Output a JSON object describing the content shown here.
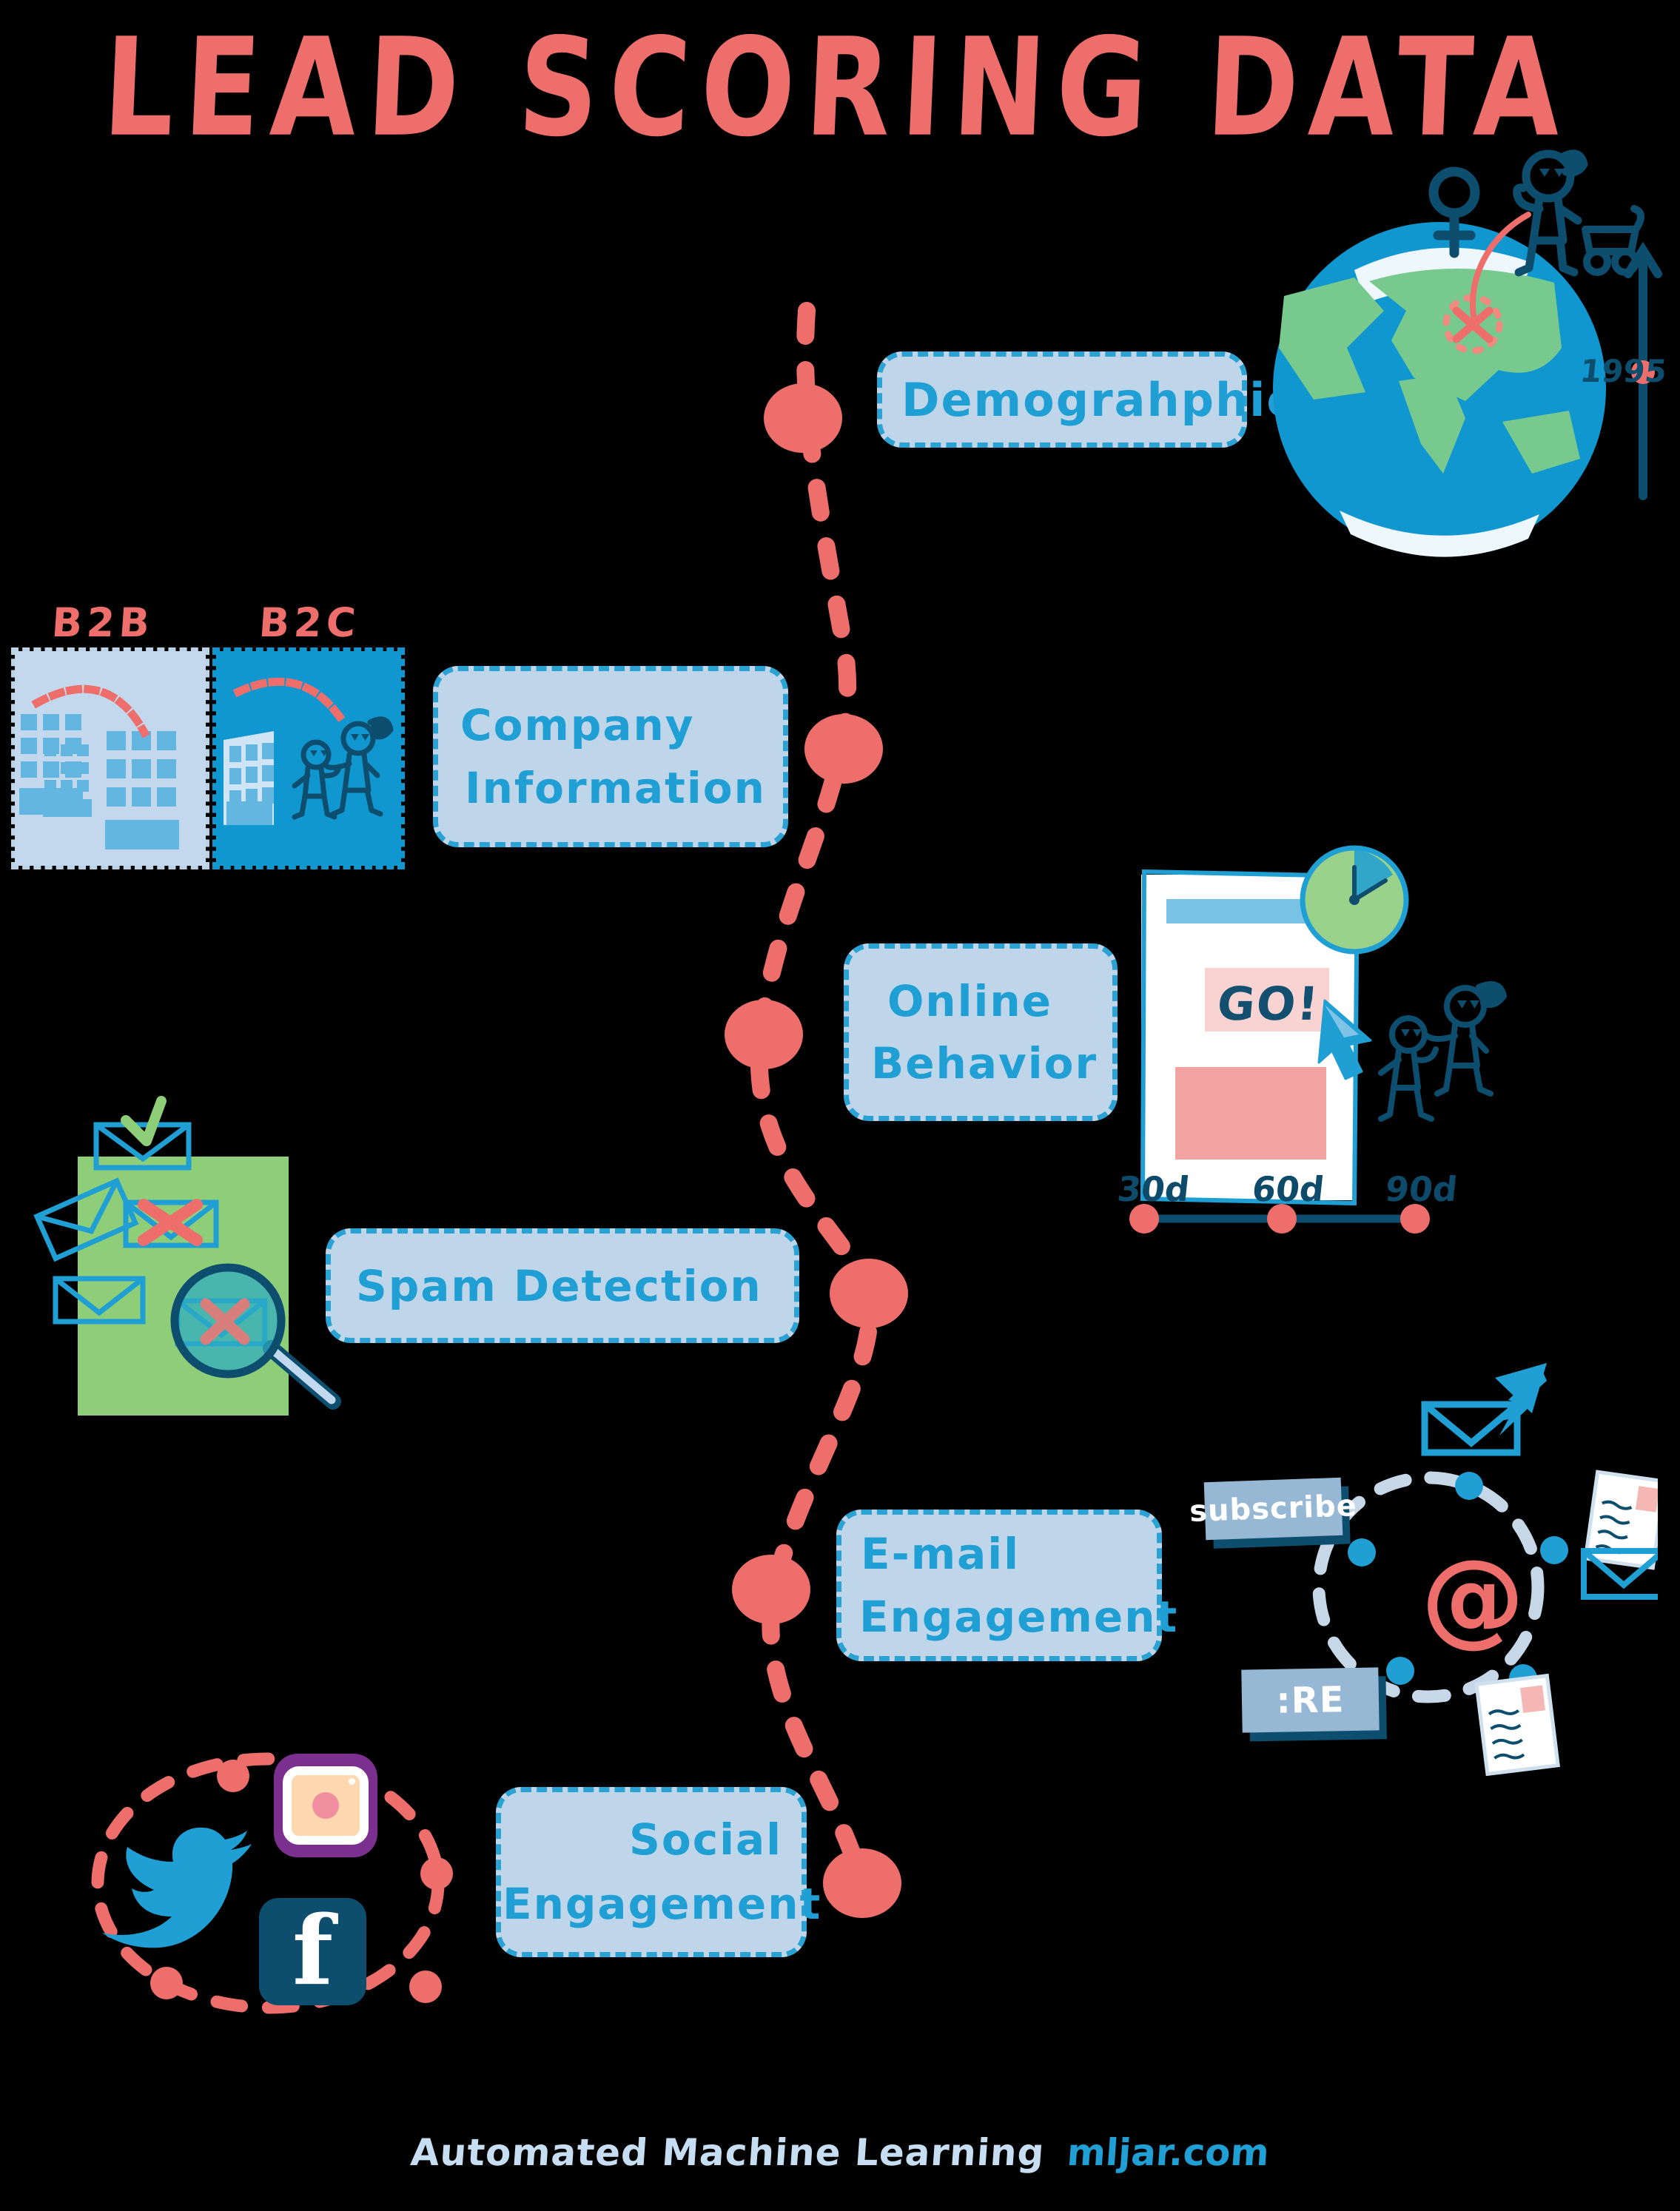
{
  "title": "LEAD SCORING DATA",
  "nodes": [
    {
      "label": "Demograhphic",
      "name": "demographic"
    },
    {
      "label_line1": "Company",
      "label_line2": "Information",
      "name": "company-information"
    },
    {
      "label_line1": "Online",
      "label_line2": "Behavior",
      "name": "online-behavior"
    },
    {
      "label": "Spam  Detection",
      "name": "spam-detection"
    },
    {
      "label_line1": "E-mail",
      "label_line2": "Engagement",
      "name": "email-engagement"
    },
    {
      "label_line1": "Social",
      "label_line2": "Engagement",
      "name": "social-engagement"
    }
  ],
  "chips": {
    "demographic": "Demograhphic",
    "company_l1": "Company",
    "company_l2": "Information",
    "online_l1": "Online",
    "online_l2": "Behavior",
    "spam": "Spam  Detection",
    "email_l1": "E-mail",
    "email_l2": "Engagement",
    "social_l1": "Social",
    "social_l2": "Engagement"
  },
  "globe": {
    "gender_symbol": "♀",
    "year_label": "1995"
  },
  "company_panels": {
    "b2b_label": "B2B",
    "b2c_label": "B2C"
  },
  "online_behavior": {
    "cta_label": "GO!",
    "timeline": [
      "30d",
      "60d",
      "90d"
    ]
  },
  "email_cluster": {
    "subscribe_tag": "subscribe",
    "reply_tag": ":RE",
    "at_symbol": "@"
  },
  "social_cluster": {
    "twitter": "twitter-bird",
    "instagram": "instagram-camera",
    "facebook": "f"
  },
  "footer": {
    "tagline": "Automated Machine Learning",
    "site": "mljar.com"
  },
  "colors": {
    "background": "#000000",
    "coral": "#ee6e6b",
    "chip_fill": "#bed5ea",
    "chip_border": "#2ba2d4",
    "chip_text": "#1f9fd4",
    "deep_blue": "#0d4d6e",
    "bright_blue": "#1197cf",
    "green": "#8fce78",
    "globe_green": "#77c98e",
    "instagram_purple": "#7b2f8e",
    "facebook_navy": "#0d4d6e",
    "footer_light": "#c6ddf2"
  }
}
